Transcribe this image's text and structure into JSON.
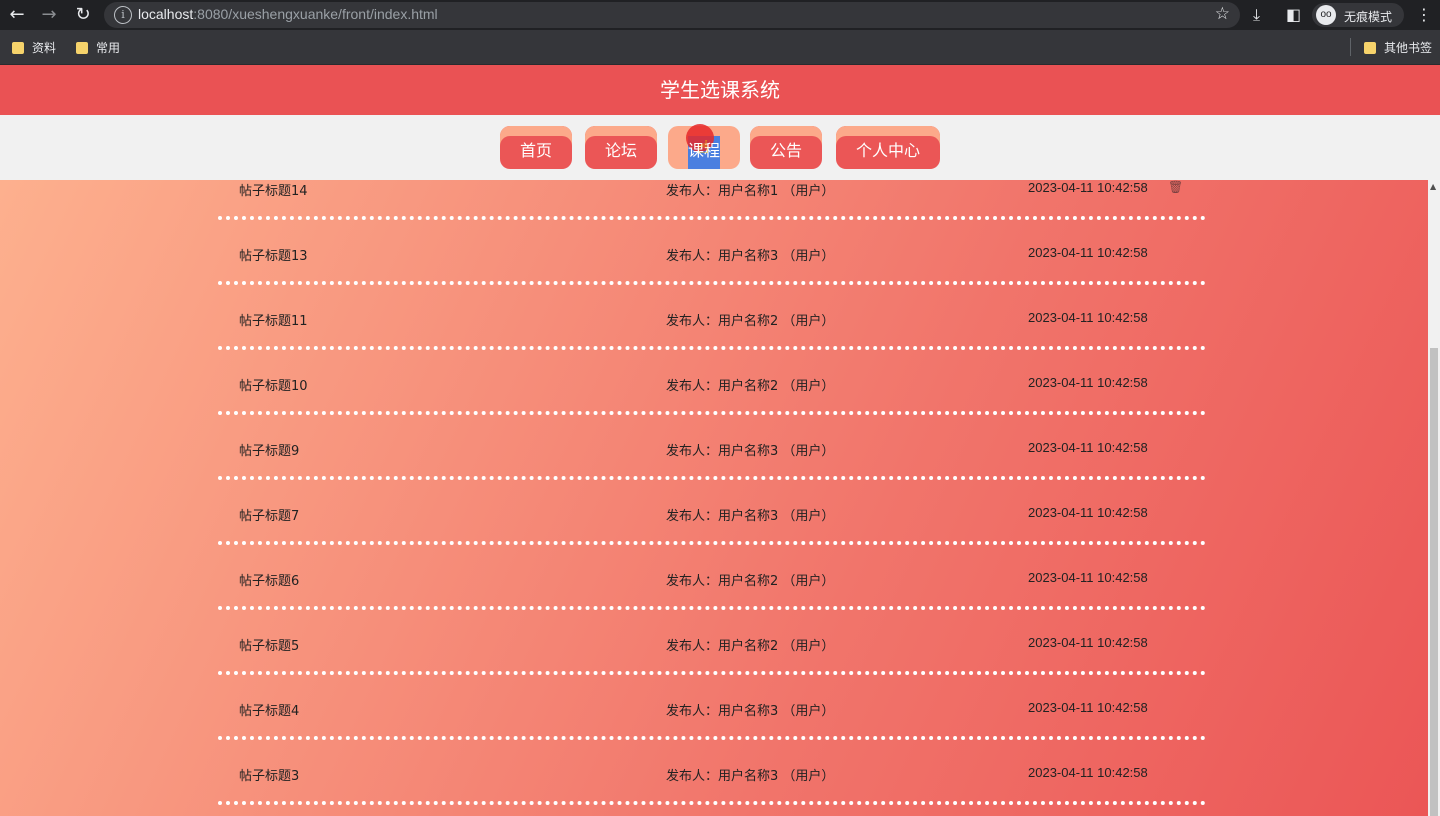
{
  "browser": {
    "url_host": "localhost",
    "url_rest": ":8080/xueshengxuanke/front/index.html",
    "incognito_label": "无痕模式",
    "bookmarks": [
      "资料",
      "常用"
    ],
    "other_bookmarks": "其他书签"
  },
  "header": {
    "title": "学生选课系统"
  },
  "nav": {
    "items": [
      {
        "label": "首页"
      },
      {
        "label": "论坛"
      },
      {
        "label": "课程"
      },
      {
        "label": "公告"
      },
      {
        "label": "个人中心"
      }
    ],
    "active_index": 2
  },
  "posts": [
    {
      "title": "帖子标题14",
      "author": "发布人：用户名称1 （用户）",
      "time": "2023-04-11 10:42:58",
      "deletable": true
    },
    {
      "title": "帖子标题13",
      "author": "发布人：用户名称3 （用户）",
      "time": "2023-04-11 10:42:58"
    },
    {
      "title": "帖子标题11",
      "author": "发布人：用户名称2 （用户）",
      "time": "2023-04-11 10:42:58"
    },
    {
      "title": "帖子标题10",
      "author": "发布人：用户名称2 （用户）",
      "time": "2023-04-11 10:42:58"
    },
    {
      "title": "帖子标题9",
      "author": "发布人：用户名称3 （用户）",
      "time": "2023-04-11 10:42:58"
    },
    {
      "title": "帖子标题7",
      "author": "发布人：用户名称3 （用户）",
      "time": "2023-04-11 10:42:58"
    },
    {
      "title": "帖子标题6",
      "author": "发布人：用户名称2 （用户）",
      "time": "2023-04-11 10:42:58"
    },
    {
      "title": "帖子标题5",
      "author": "发布人：用户名称2 （用户）",
      "time": "2023-04-11 10:42:58"
    },
    {
      "title": "帖子标题4",
      "author": "发布人：用户名称3 （用户）",
      "time": "2023-04-11 10:42:58"
    },
    {
      "title": "帖子标题3",
      "author": "发布人：用户名称3 （用户）",
      "time": "2023-04-11 10:42:58"
    }
  ],
  "colors": {
    "primary": "#ea5254",
    "accent": "#fca98a"
  }
}
